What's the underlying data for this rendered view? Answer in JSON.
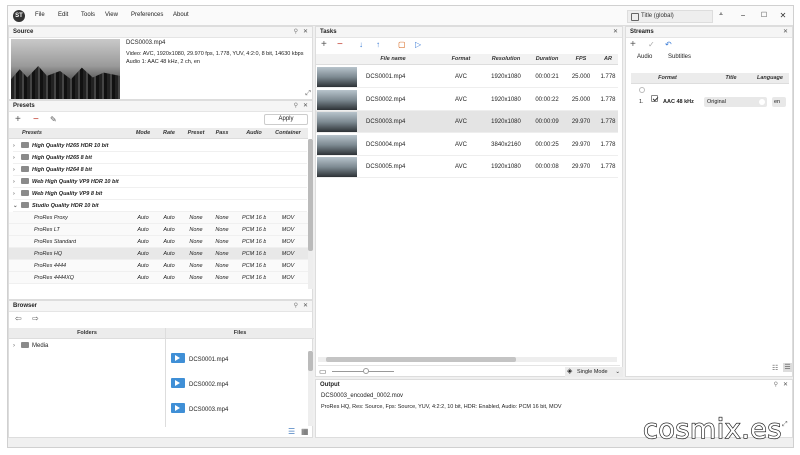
{
  "menubar": {
    "logo": "ST",
    "items": [
      "File",
      "Edit",
      "Tools",
      "View",
      "Preferences",
      "About"
    ],
    "title_field": "Title (global)"
  },
  "source": {
    "header": "Source",
    "filename": "DCS0003.mp4",
    "video": "Video: AVC, 1920x1080, 29.970 fps, 1.778, YUV, 4:2:0, 8 bit, 14630 kbps",
    "audio": "Audio 1: AAC  48 kHz, 2 ch, en"
  },
  "presets": {
    "header": "Presets",
    "apply_label": "Apply",
    "columns": [
      "Presets",
      "Mode",
      "Rate",
      "Preset",
      "Pass",
      "Audio",
      "Container"
    ],
    "groups": [
      "High Quality H265 HDR 10 bit",
      "High Quality H265 8 bit",
      "High Quality H264 8 bit",
      "Web High Quality VP9 HDR 10 bit",
      "Web High Quality VP9 8 bit",
      "Studio Quality HDR 10 bit"
    ],
    "items": [
      [
        "ProRes Proxy",
        "Auto",
        "Auto",
        "None",
        "None",
        "PCM 16 bit",
        "MOV"
      ],
      [
        "ProRes LT",
        "Auto",
        "Auto",
        "None",
        "None",
        "PCM 16 bit",
        "MOV"
      ],
      [
        "ProRes Standard",
        "Auto",
        "Auto",
        "None",
        "None",
        "PCM 16 bit",
        "MOV"
      ],
      [
        "ProRes HQ",
        "Auto",
        "Auto",
        "None",
        "None",
        "PCM 16 bit",
        "MOV"
      ],
      [
        "ProRes 4444",
        "Auto",
        "Auto",
        "None",
        "None",
        "PCM 16 bit",
        "MOV"
      ],
      [
        "ProRes 4444XQ",
        "Auto",
        "Auto",
        "None",
        "None",
        "PCM 16 bit",
        "MOV"
      ]
    ]
  },
  "browser": {
    "header": "Browser",
    "folders_col": "Folders",
    "files_col": "Files",
    "folder": "Media",
    "files": [
      "DCS0001.mp4",
      "DCS0002.mp4",
      "DCS0003.mp4"
    ]
  },
  "tasks": {
    "header": "Tasks",
    "columns": [
      "File name",
      "Format",
      "Resolution",
      "Duration",
      "FPS",
      "AR"
    ],
    "rows": [
      [
        "DCS0001.mp4",
        "AVC",
        "1920x1080",
        "00:00:21",
        "25.000",
        "1.778"
      ],
      [
        "DCS0002.mp4",
        "AVC",
        "1920x1080",
        "00:00:22",
        "25.000",
        "1.778"
      ],
      [
        "DCS0003.mp4",
        "AVC",
        "1920x1080",
        "00:00:09",
        "29.970",
        "1.778"
      ],
      [
        "DCS0004.mp4",
        "AVC",
        "3840x2160",
        "00:00:25",
        "29.970",
        "1.778"
      ],
      [
        "DCS0005.mp4",
        "AVC",
        "1920x1080",
        "00:00:08",
        "29.970",
        "1.778"
      ]
    ],
    "mode_label": "Single Mode"
  },
  "streams": {
    "header": "Streams",
    "tabs": [
      "Audio",
      "Subtitles"
    ],
    "columns": [
      "Format",
      "Title",
      "Language"
    ],
    "row": {
      "index": "1.",
      "format": "AAC  48 kHz",
      "title": "Original",
      "language": "en"
    }
  },
  "output": {
    "header": "Output",
    "filename": "DCS0003_encoded_0002.mov",
    "details": "ProRes HQ, Res: Source, Fps: Source, YUV, 4:2:2, 10 bit, HDR: Enabled, Audio: PCM 16 bit, MOV"
  },
  "watermark": "cosmix.es"
}
